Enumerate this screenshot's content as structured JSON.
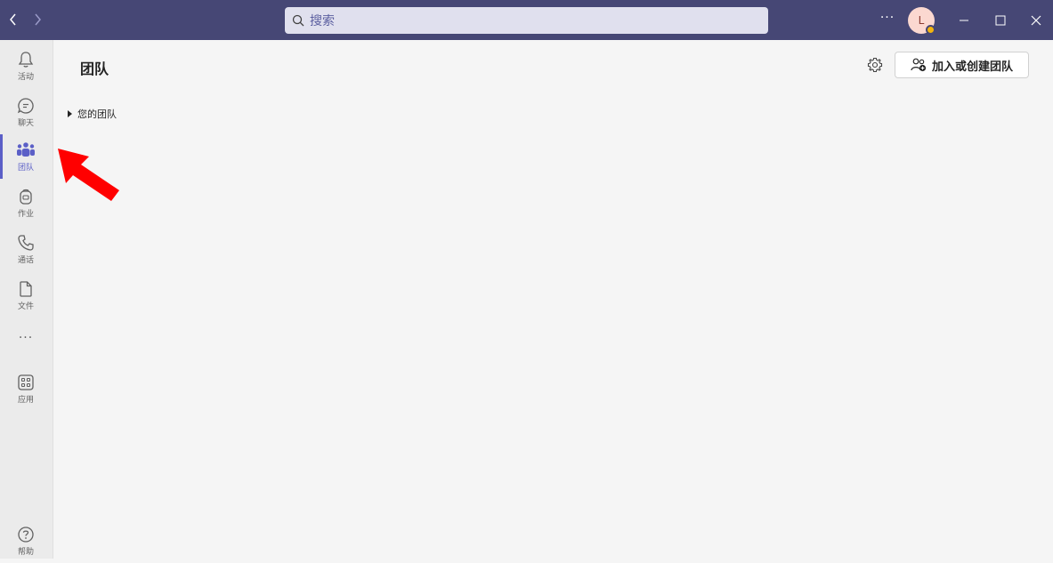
{
  "titlebar": {
    "search_placeholder": "搜索",
    "more_label": "···",
    "avatar_initial": "L",
    "presence_color": "#f2b40f",
    "bar_color": "#464775"
  },
  "rail": {
    "items": [
      {
        "label": "活动",
        "icon": "bell-icon"
      },
      {
        "label": "聊天",
        "icon": "chat-icon"
      },
      {
        "label": "团队",
        "icon": "teams-icon",
        "active": true
      },
      {
        "label": "作业",
        "icon": "backpack-icon"
      },
      {
        "label": "通话",
        "icon": "phone-icon"
      },
      {
        "label": "文件",
        "icon": "file-icon"
      },
      {
        "label": "应用",
        "icon": "apps-icon"
      },
      {
        "label": "帮助",
        "icon": "help-icon"
      }
    ],
    "more_label": "···",
    "accent_color": "#5b5fc7"
  },
  "main": {
    "title": "团队",
    "join_button_label": "加入或创建团队",
    "tree": {
      "section_label": "您的团队"
    }
  },
  "annotation": {
    "arrow_color": "#ff0000"
  }
}
